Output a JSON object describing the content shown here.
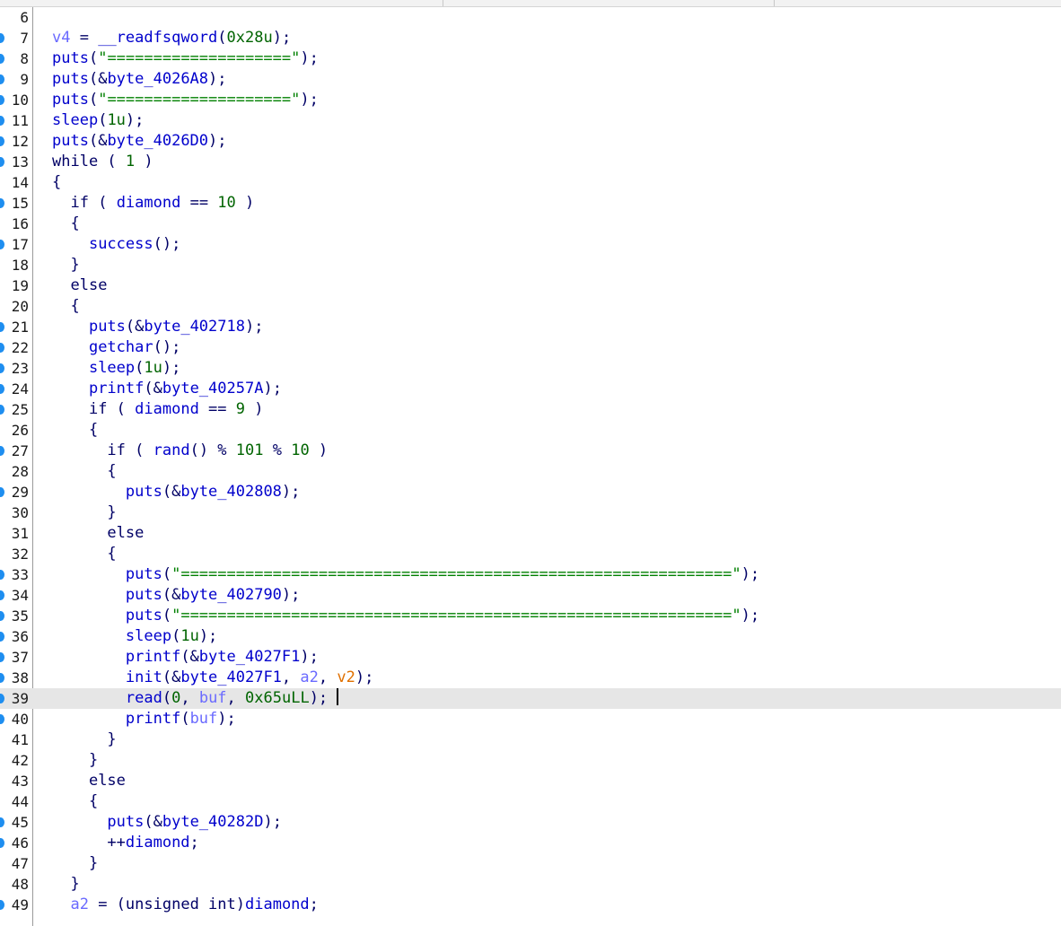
{
  "editor": {
    "colors": {
      "func": "#0000cc",
      "keyword": "#000066",
      "global": "#0000cc",
      "local": "#6a6aff",
      "number": "#006400",
      "string": "#008000",
      "punct": "#000066",
      "arg": "#e07000",
      "breakpoint_dot": "#1e8ef0"
    },
    "lines": [
      {
        "n": "6",
        "dot": false,
        "tokens": []
      },
      {
        "n": "7",
        "dot": true,
        "tokens": [
          [
            "local",
            "v4"
          ],
          [
            "punct",
            " = "
          ],
          [
            "func",
            "__readfsqword"
          ],
          [
            "punct",
            "("
          ],
          [
            "number",
            "0x28u"
          ],
          [
            "punct",
            ");"
          ]
        ]
      },
      {
        "n": "8",
        "dot": true,
        "tokens": [
          [
            "func",
            "puts"
          ],
          [
            "punct",
            "("
          ],
          [
            "string",
            "\"====================\""
          ],
          [
            "punct",
            ");"
          ]
        ]
      },
      {
        "n": "9",
        "dot": true,
        "tokens": [
          [
            "func",
            "puts"
          ],
          [
            "punct",
            "(&"
          ],
          [
            "global",
            "byte_4026A8"
          ],
          [
            "punct",
            ");"
          ]
        ]
      },
      {
        "n": "10",
        "dot": true,
        "tokens": [
          [
            "func",
            "puts"
          ],
          [
            "punct",
            "("
          ],
          [
            "string",
            "\"====================\""
          ],
          [
            "punct",
            ");"
          ]
        ]
      },
      {
        "n": "11",
        "dot": true,
        "tokens": [
          [
            "func",
            "sleep"
          ],
          [
            "punct",
            "("
          ],
          [
            "number",
            "1u"
          ],
          [
            "punct",
            ");"
          ]
        ]
      },
      {
        "n": "12",
        "dot": true,
        "tokens": [
          [
            "func",
            "puts"
          ],
          [
            "punct",
            "(&"
          ],
          [
            "global",
            "byte_4026D0"
          ],
          [
            "punct",
            ");"
          ]
        ]
      },
      {
        "n": "13",
        "dot": true,
        "tokens": [
          [
            "keyword",
            "while"
          ],
          [
            "punct",
            " ( "
          ],
          [
            "number",
            "1"
          ],
          [
            "punct",
            " )"
          ]
        ]
      },
      {
        "n": "14",
        "dot": false,
        "tokens": [
          [
            "punct",
            "{"
          ]
        ]
      },
      {
        "n": "15",
        "dot": true,
        "tokens": [
          [
            "punct",
            "  "
          ],
          [
            "keyword",
            "if"
          ],
          [
            "punct",
            " ( "
          ],
          [
            "global",
            "diamond"
          ],
          [
            "punct",
            " == "
          ],
          [
            "number",
            "10"
          ],
          [
            "punct",
            " )"
          ]
        ]
      },
      {
        "n": "16",
        "dot": false,
        "tokens": [
          [
            "punct",
            "  {"
          ]
        ]
      },
      {
        "n": "17",
        "dot": true,
        "tokens": [
          [
            "punct",
            "    "
          ],
          [
            "func",
            "success"
          ],
          [
            "punct",
            "();"
          ]
        ]
      },
      {
        "n": "18",
        "dot": false,
        "tokens": [
          [
            "punct",
            "  }"
          ]
        ]
      },
      {
        "n": "19",
        "dot": false,
        "tokens": [
          [
            "punct",
            "  "
          ],
          [
            "keyword",
            "else"
          ]
        ]
      },
      {
        "n": "20",
        "dot": false,
        "tokens": [
          [
            "punct",
            "  {"
          ]
        ]
      },
      {
        "n": "21",
        "dot": true,
        "tokens": [
          [
            "punct",
            "    "
          ],
          [
            "func",
            "puts"
          ],
          [
            "punct",
            "(&"
          ],
          [
            "global",
            "byte_402718"
          ],
          [
            "punct",
            ");"
          ]
        ]
      },
      {
        "n": "22",
        "dot": true,
        "tokens": [
          [
            "punct",
            "    "
          ],
          [
            "func",
            "getchar"
          ],
          [
            "punct",
            "();"
          ]
        ]
      },
      {
        "n": "23",
        "dot": true,
        "tokens": [
          [
            "punct",
            "    "
          ],
          [
            "func",
            "sleep"
          ],
          [
            "punct",
            "("
          ],
          [
            "number",
            "1u"
          ],
          [
            "punct",
            ");"
          ]
        ]
      },
      {
        "n": "24",
        "dot": true,
        "tokens": [
          [
            "punct",
            "    "
          ],
          [
            "func",
            "printf"
          ],
          [
            "punct",
            "(&"
          ],
          [
            "global",
            "byte_40257A"
          ],
          [
            "punct",
            ");"
          ]
        ]
      },
      {
        "n": "25",
        "dot": true,
        "tokens": [
          [
            "punct",
            "    "
          ],
          [
            "keyword",
            "if"
          ],
          [
            "punct",
            " ( "
          ],
          [
            "global",
            "diamond"
          ],
          [
            "punct",
            " == "
          ],
          [
            "number",
            "9"
          ],
          [
            "punct",
            " )"
          ]
        ]
      },
      {
        "n": "26",
        "dot": false,
        "tokens": [
          [
            "punct",
            "    {"
          ]
        ]
      },
      {
        "n": "27",
        "dot": true,
        "tokens": [
          [
            "punct",
            "      "
          ],
          [
            "keyword",
            "if"
          ],
          [
            "punct",
            " ( "
          ],
          [
            "func",
            "rand"
          ],
          [
            "punct",
            "() % "
          ],
          [
            "number",
            "101"
          ],
          [
            "punct",
            " % "
          ],
          [
            "number",
            "10"
          ],
          [
            "punct",
            " )"
          ]
        ]
      },
      {
        "n": "28",
        "dot": false,
        "tokens": [
          [
            "punct",
            "      {"
          ]
        ]
      },
      {
        "n": "29",
        "dot": true,
        "tokens": [
          [
            "punct",
            "        "
          ],
          [
            "func",
            "puts"
          ],
          [
            "punct",
            "(&"
          ],
          [
            "global",
            "byte_402808"
          ],
          [
            "punct",
            ");"
          ]
        ]
      },
      {
        "n": "30",
        "dot": false,
        "tokens": [
          [
            "punct",
            "      }"
          ]
        ]
      },
      {
        "n": "31",
        "dot": false,
        "tokens": [
          [
            "punct",
            "      "
          ],
          [
            "keyword",
            "else"
          ]
        ]
      },
      {
        "n": "32",
        "dot": false,
        "tokens": [
          [
            "punct",
            "      {"
          ]
        ]
      },
      {
        "n": "33",
        "dot": true,
        "tokens": [
          [
            "punct",
            "        "
          ],
          [
            "func",
            "puts"
          ],
          [
            "punct",
            "("
          ],
          [
            "string",
            "\"============================================================\""
          ],
          [
            "punct",
            ");"
          ]
        ]
      },
      {
        "n": "34",
        "dot": true,
        "tokens": [
          [
            "punct",
            "        "
          ],
          [
            "func",
            "puts"
          ],
          [
            "punct",
            "(&"
          ],
          [
            "global",
            "byte_402790"
          ],
          [
            "punct",
            ");"
          ]
        ]
      },
      {
        "n": "35",
        "dot": true,
        "tokens": [
          [
            "punct",
            "        "
          ],
          [
            "func",
            "puts"
          ],
          [
            "punct",
            "("
          ],
          [
            "string",
            "\"============================================================\""
          ],
          [
            "punct",
            ");"
          ]
        ]
      },
      {
        "n": "36",
        "dot": true,
        "tokens": [
          [
            "punct",
            "        "
          ],
          [
            "func",
            "sleep"
          ],
          [
            "punct",
            "("
          ],
          [
            "number",
            "1u"
          ],
          [
            "punct",
            ");"
          ]
        ]
      },
      {
        "n": "37",
        "dot": true,
        "tokens": [
          [
            "punct",
            "        "
          ],
          [
            "func",
            "printf"
          ],
          [
            "punct",
            "(&"
          ],
          [
            "global",
            "byte_4027F1"
          ],
          [
            "punct",
            ");"
          ]
        ]
      },
      {
        "n": "38",
        "dot": true,
        "tokens": [
          [
            "punct",
            "        "
          ],
          [
            "func",
            "init"
          ],
          [
            "punct",
            "(&"
          ],
          [
            "global",
            "byte_4027F1"
          ],
          [
            "punct",
            ", "
          ],
          [
            "local",
            "a2"
          ],
          [
            "punct",
            ", "
          ],
          [
            "arg",
            "v2"
          ],
          [
            "punct",
            ");"
          ]
        ]
      },
      {
        "n": "39",
        "dot": true,
        "current": true,
        "tokens": [
          [
            "punct",
            "        "
          ],
          [
            "func",
            "read"
          ],
          [
            "punct",
            "("
          ],
          [
            "number",
            "0"
          ],
          [
            "punct",
            ", "
          ],
          [
            "local",
            "buf"
          ],
          [
            "punct",
            ", "
          ],
          [
            "number",
            "0x65uLL"
          ],
          [
            "punct",
            "); "
          ]
        ]
      },
      {
        "n": "40",
        "dot": true,
        "tokens": [
          [
            "punct",
            "        "
          ],
          [
            "func",
            "printf"
          ],
          [
            "punct",
            "("
          ],
          [
            "local",
            "buf"
          ],
          [
            "punct",
            ");"
          ]
        ]
      },
      {
        "n": "41",
        "dot": false,
        "tokens": [
          [
            "punct",
            "      }"
          ]
        ]
      },
      {
        "n": "42",
        "dot": false,
        "tokens": [
          [
            "punct",
            "    }"
          ]
        ]
      },
      {
        "n": "43",
        "dot": false,
        "tokens": [
          [
            "punct",
            "    "
          ],
          [
            "keyword",
            "else"
          ]
        ]
      },
      {
        "n": "44",
        "dot": false,
        "tokens": [
          [
            "punct",
            "    {"
          ]
        ]
      },
      {
        "n": "45",
        "dot": true,
        "tokens": [
          [
            "punct",
            "      "
          ],
          [
            "func",
            "puts"
          ],
          [
            "punct",
            "(&"
          ],
          [
            "global",
            "byte_40282D"
          ],
          [
            "punct",
            ");"
          ]
        ]
      },
      {
        "n": "46",
        "dot": true,
        "tokens": [
          [
            "punct",
            "      ++"
          ],
          [
            "global",
            "diamond"
          ],
          [
            "punct",
            ";"
          ]
        ]
      },
      {
        "n": "47",
        "dot": false,
        "tokens": [
          [
            "punct",
            "    }"
          ]
        ]
      },
      {
        "n": "48",
        "dot": false,
        "tokens": [
          [
            "punct",
            "  }"
          ]
        ]
      },
      {
        "n": "49",
        "dot": true,
        "tokens": [
          [
            "punct",
            "  "
          ],
          [
            "local",
            "a2"
          ],
          [
            "punct",
            " = ("
          ],
          [
            "keyword",
            "unsigned int"
          ],
          [
            "punct",
            ")"
          ],
          [
            "global",
            "diamond"
          ],
          [
            "punct",
            ";"
          ]
        ]
      }
    ]
  }
}
